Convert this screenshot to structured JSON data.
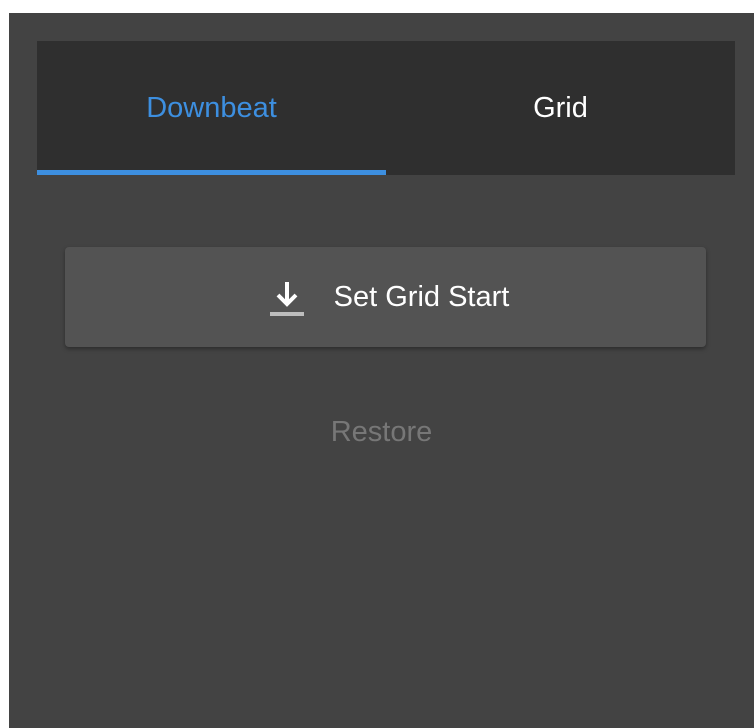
{
  "colors": {
    "accent": "#3d8fe0",
    "panel_bg": "#434343",
    "tabbar_bg": "#2f2f2f",
    "button_bg": "#535353",
    "disabled_text": "#777777"
  },
  "tabs": [
    {
      "label": "Downbeat",
      "active": true
    },
    {
      "label": "Grid",
      "active": false
    }
  ],
  "set_grid_button": {
    "icon": "download-icon",
    "label": "Set Grid Start"
  },
  "restore": {
    "label": "Restore",
    "enabled": false
  }
}
